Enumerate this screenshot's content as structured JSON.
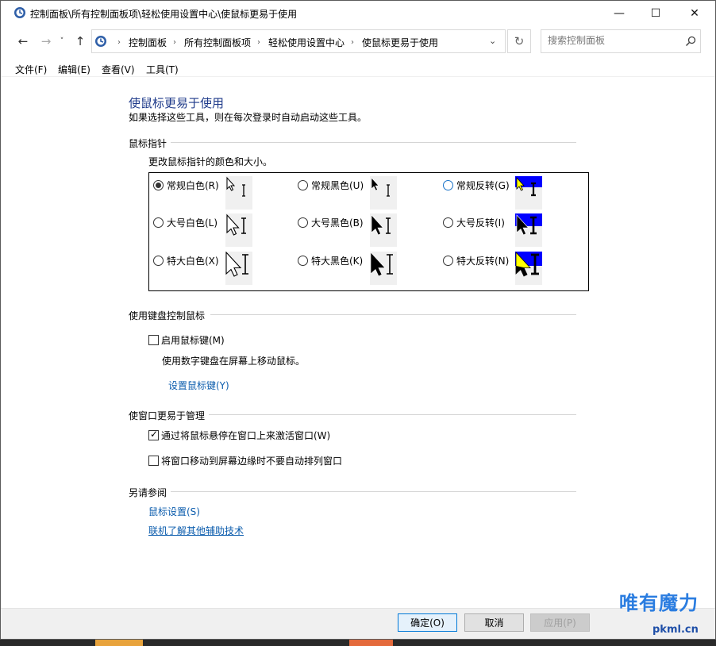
{
  "window": {
    "title": "控制面板\\所有控制面板项\\轻松使用设置中心\\使鼠标更易于使用",
    "minimize": "—",
    "maximize": "☐",
    "close": "✕"
  },
  "nav": {
    "back": "←",
    "forward": "→",
    "recent": "˅",
    "up": "↑",
    "breadcrumbs": [
      "控制面板",
      "所有控制面板项",
      "轻松使用设置中心",
      "使鼠标更易于使用"
    ],
    "separator": "›",
    "address_dropdown": "⌄",
    "refresh": "↻",
    "search_placeholder": "搜索控制面板"
  },
  "menu": {
    "file": "文件(F)",
    "edit": "编辑(E)",
    "view": "查看(V)",
    "tools": "工具(T)"
  },
  "page": {
    "title": "使鼠标更易于使用",
    "subtitle": "如果选择这些工具，则在每次登录时自动启动这些工具。"
  },
  "pointer": {
    "header": "鼠标指针",
    "description": "更改鼠标指针的颜色和大小。",
    "options": [
      {
        "label": "常规白色(R)",
        "checked": true
      },
      {
        "label": "常规黑色(U)",
        "checked": false
      },
      {
        "label": "常规反转(G)",
        "checked": false
      },
      {
        "label": "大号白色(L)",
        "checked": false
      },
      {
        "label": "大号黑色(B)",
        "checked": false
      },
      {
        "label": "大号反转(I)",
        "checked": false
      },
      {
        "label": "特大白色(X)",
        "checked": false
      },
      {
        "label": "特大黑色(K)",
        "checked": false
      },
      {
        "label": "特大反转(N)",
        "checked": false
      }
    ]
  },
  "keyboard": {
    "header": "使用键盘控制鼠标",
    "enable_label": "启用鼠标键(M)",
    "enable_checked": false,
    "description": "使用数字键盘在屏幕上移动鼠标。",
    "setup_link": "设置鼠标键(Y)"
  },
  "windows": {
    "header": "使窗口更易于管理",
    "hover_label": "通过将鼠标悬停在窗口上来激活窗口(W)",
    "hover_checked": true,
    "snap_label": "将窗口移动到屏幕边缘时不要自动排列窗口",
    "snap_checked": false
  },
  "see_also": {
    "header": "另请参阅",
    "mouse_settings": "鼠标设置(S)",
    "online_link": "联机了解其他辅助技术"
  },
  "footer": {
    "ok": "确定(O)",
    "cancel": "取消",
    "apply": "应用(P)"
  },
  "watermark": {
    "text": "唯有魔力",
    "url": "pkml.cn"
  },
  "colors": {
    "title_blue": "#1e3a8a",
    "link_blue": "#0b5cad",
    "inverse_blue": "#0000ff"
  }
}
